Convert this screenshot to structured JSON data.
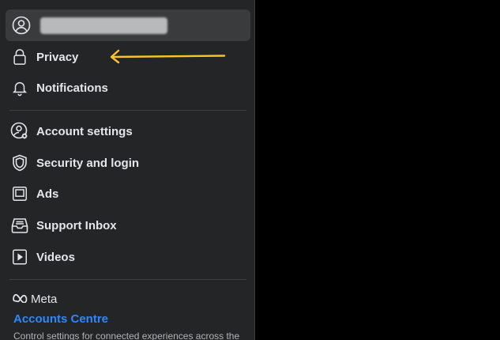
{
  "sidebar": {
    "profile": {
      "icon": "user-circle-icon"
    },
    "items": [
      {
        "label": "Privacy",
        "icon": "lock-icon"
      },
      {
        "label": "Notifications",
        "icon": "bell-icon"
      },
      {
        "label": "Account settings",
        "icon": "user-gear-icon"
      },
      {
        "label": "Security and login",
        "icon": "shield-icon"
      },
      {
        "label": "Ads",
        "icon": "ads-icon"
      },
      {
        "label": "Support Inbox",
        "icon": "inbox-icon"
      },
      {
        "label": "Videos",
        "icon": "video-icon"
      }
    ],
    "meta": {
      "logo_text": "Meta",
      "link_label": "Accounts Centre",
      "description": "Control settings for connected experiences across the"
    }
  },
  "annotation": {
    "arrow_color": "#f7c52b"
  },
  "colors": {
    "link": "#2d88ff",
    "text": "#e4e6eb",
    "sidebar_bg": "#242526"
  }
}
